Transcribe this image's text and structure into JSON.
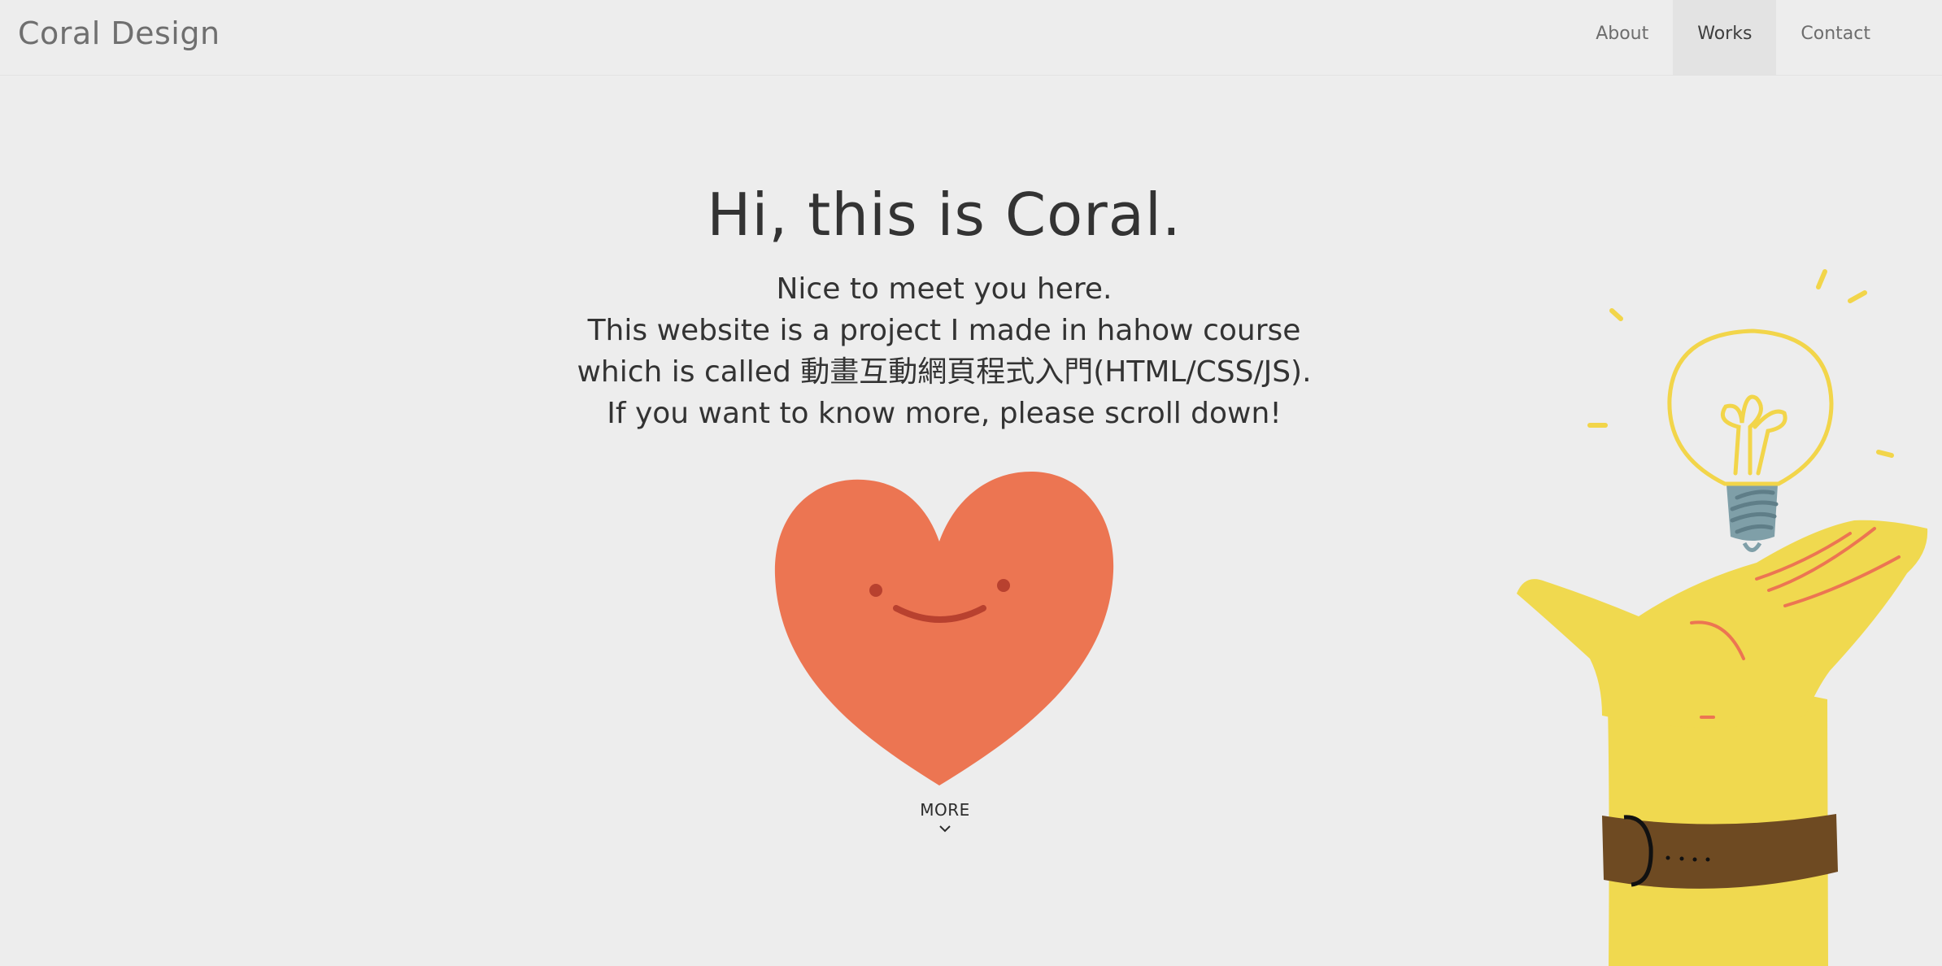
{
  "header": {
    "brand": "Coral Design",
    "nav": [
      {
        "label": "About",
        "active": false
      },
      {
        "label": "Works",
        "active": true
      },
      {
        "label": "Contact",
        "active": false
      }
    ]
  },
  "hero": {
    "title": "Hi, this is Coral.",
    "lines": [
      "Nice to meet you here.",
      "This website is a project I made in hahow course",
      "which is called 動畫互動網頁程式入門(HTML/CSS/JS).",
      "If you want to know more, please scroll down!"
    ]
  },
  "more": {
    "label": "MORE",
    "icon": "chevron-down-icon"
  },
  "colors": {
    "background": "#ededed",
    "heart": "#ec7552",
    "hand": "#f0d94f",
    "bulb": "#f2d54a",
    "watch_strap": "#6e4a22",
    "bulb_base": "#7f9fa8",
    "text": "#333333"
  }
}
